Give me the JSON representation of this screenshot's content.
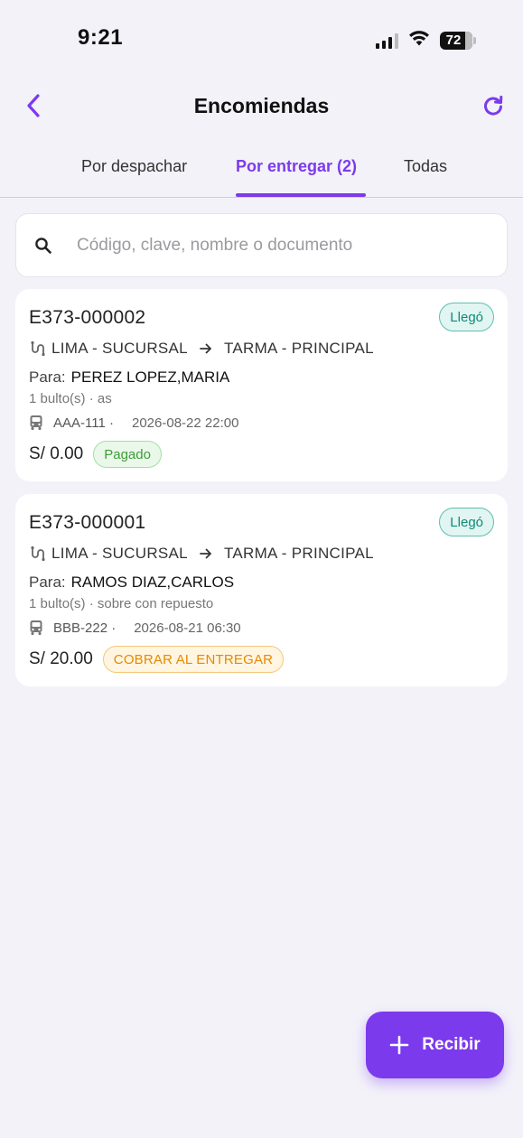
{
  "status_bar": {
    "time": "9:21",
    "battery": "72",
    "icons": [
      "signal-icon",
      "wifi-icon",
      "battery-icon"
    ]
  },
  "header": {
    "title": "Encomiendas",
    "back_icon": "chevron-left-icon",
    "refresh_icon": "refresh-icon"
  },
  "tabs": [
    {
      "label": "Por despachar",
      "active": false
    },
    {
      "label": "Por entregar (2)",
      "active": true
    },
    {
      "label": "Todas",
      "active": false
    }
  ],
  "search": {
    "placeholder": "Código, clave, nombre o documento",
    "value": ""
  },
  "shipments": [
    {
      "code": "E373-000002",
      "status": "Llegó",
      "origin": "LIMA - SUCURSAL",
      "destination": "TARMA - PRINCIPAL",
      "recipient_label": "Para:",
      "recipient": "PEREZ LOPEZ,MARIA",
      "package": "1 bulto(s) · as",
      "vehicle": "AAA-111 ·",
      "datetime": "2026-08-22 22:00",
      "price": "S/ 0.00",
      "payment": "Pagado"
    },
    {
      "code": "E373-000001",
      "status": "Llegó",
      "origin": "LIMA - SUCURSAL",
      "destination": "TARMA - PRINCIPAL",
      "recipient_label": "Para:",
      "recipient": "RAMOS DIAZ,CARLOS",
      "package": "1 bulto(s) · sobre con repuesto",
      "vehicle": "BBB-222 ·",
      "datetime": "2026-08-21 06:30",
      "price": "S/ 20.00",
      "payment": "COBRAR AL ENTREGAR"
    }
  ],
  "fab": {
    "label": "Recibir",
    "icon": "plus-icon"
  },
  "colors": {
    "accent": "#7c3aed",
    "arrived": "#0f8a78",
    "paid": "#3f9c3a",
    "cod": "#e68a00",
    "background": "#f3f2f9"
  }
}
